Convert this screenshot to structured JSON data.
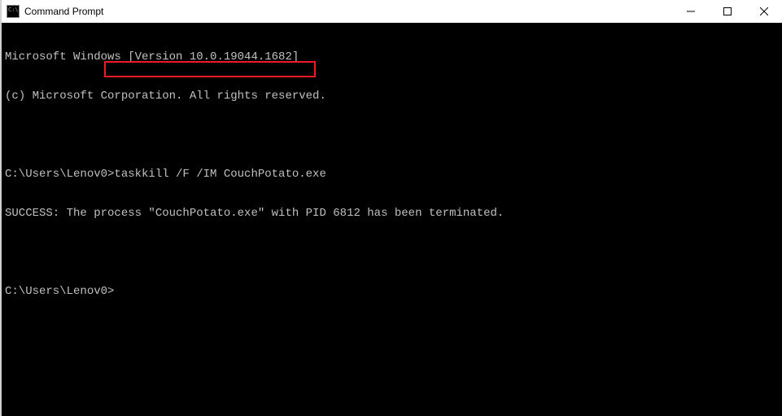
{
  "titlebar": {
    "title": "Command Prompt"
  },
  "terminal": {
    "lines": {
      "l0": "Microsoft Windows [Version 10.0.19044.1682]",
      "l1": "(c) Microsoft Corporation. All rights reserved.",
      "l2": "",
      "prompt1": "C:\\Users\\Lenov0>",
      "cmd1": "taskkill /F /IM CouchPotato.exe",
      "l4": "SUCCESS: The process \"CouchPotato.exe\" with PID 6812 has been terminated.",
      "l5": "",
      "prompt2": "C:\\Users\\Lenov0>"
    }
  },
  "highlight": {
    "top": "47",
    "left": "126",
    "width": "260",
    "height": "20"
  }
}
